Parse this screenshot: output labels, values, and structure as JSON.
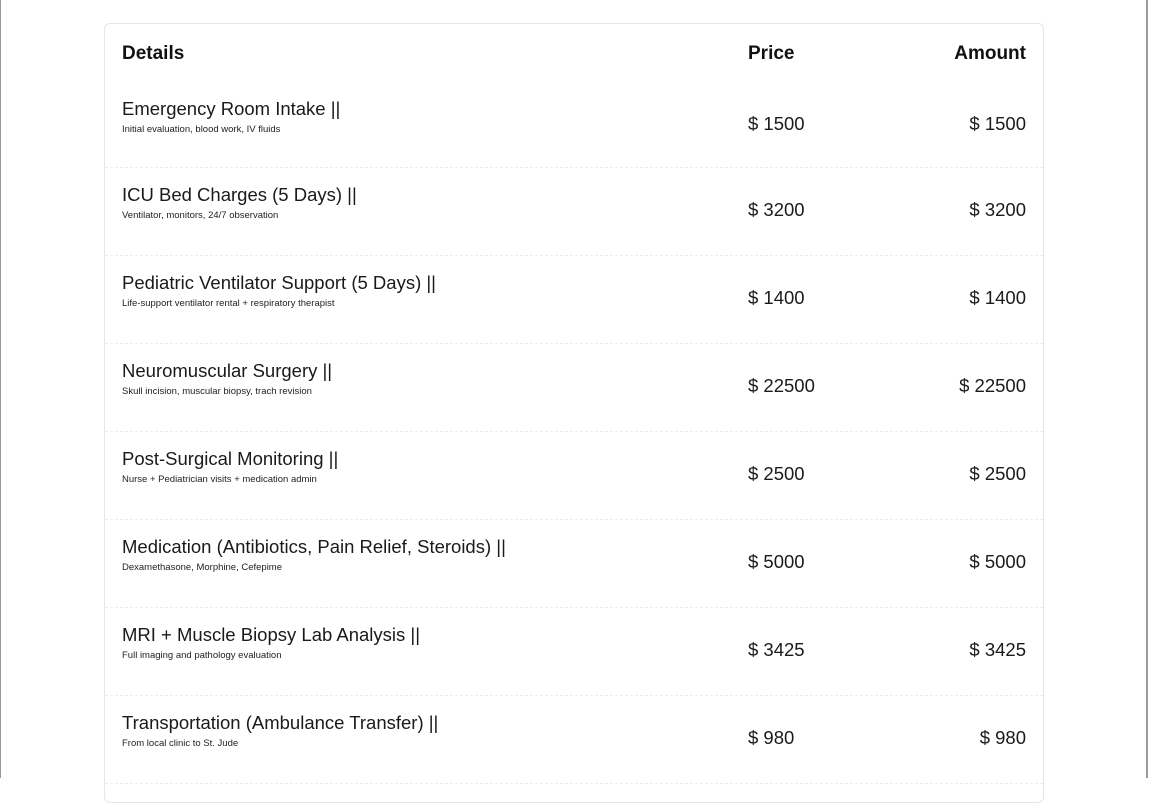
{
  "table": {
    "headers": {
      "details": "Details",
      "price": "Price",
      "amount": "Amount"
    },
    "rows": [
      {
        "name": "Emergency Room Intake ||",
        "description": "Initial evaluation, blood work, IV fluids",
        "price": "$ 1500",
        "amount": "$ 1500"
      },
      {
        "name": "ICU Bed Charges (5 Days) ||",
        "description": "Ventilator, monitors, 24/7 observation",
        "price": "$ 3200",
        "amount": "$ 3200"
      },
      {
        "name": "Pediatric Ventilator Support (5 Days) ||",
        "description": "Life-support ventilator rental + respiratory therapist",
        "price": "$ 1400",
        "amount": "$ 1400"
      },
      {
        "name": "Neuromuscular Surgery ||",
        "description": "Skull incision, muscular biopsy, trach revision",
        "price": "$ 22500",
        "amount": "$ 22500"
      },
      {
        "name": "Post-Surgical Monitoring ||",
        "description": "Nurse + Pediatrician visits + medication admin",
        "price": "$ 2500",
        "amount": "$ 2500"
      },
      {
        "name": "Medication (Antibiotics, Pain Relief, Steroids) ||",
        "description": "Dexamethasone, Morphine, Cefepime",
        "price": "$ 5000",
        "amount": "$ 5000"
      },
      {
        "name": "MRI + Muscle Biopsy Lab Analysis ||",
        "description": "Full imaging and pathology evaluation",
        "price": "$ 3425",
        "amount": "$ 3425"
      },
      {
        "name": "Transportation (Ambulance Transfer) ||",
        "description": "From local clinic to St. Jude",
        "price": "$ 980",
        "amount": "$ 980"
      }
    ]
  }
}
